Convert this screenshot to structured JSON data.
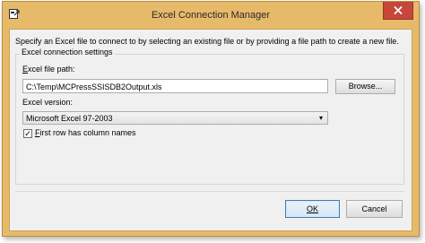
{
  "window": {
    "title": "Excel Connection Manager"
  },
  "dialog": {
    "description": "Specify an Excel file to connect to by selecting an existing file or by providing a file path to create a new file.",
    "group_title": "Excel connection settings",
    "file_path_label_key": "E",
    "file_path_label_rest": "xcel file path:",
    "file_path_value": "C:\\Temp\\MCPressSSISDB2Output.xls",
    "browse_button": "Browse...",
    "version_label": "Excel version:",
    "version_selected": "Microsoft Excel 97-2003",
    "first_row_key": "F",
    "first_row_rest": "irst row has column names",
    "first_row_checked": true,
    "ok_button": "OK",
    "cancel_button": "Cancel"
  },
  "icons": {
    "app_icon": "excel-connection-icon",
    "close_icon": "close-icon",
    "dropdown_icon": "chevron-down-icon",
    "check_icon": "checkmark-icon"
  },
  "colors": {
    "frame": "#e7ba6a",
    "close_button": "#c7463a",
    "client_background": "#f0f0f0"
  }
}
